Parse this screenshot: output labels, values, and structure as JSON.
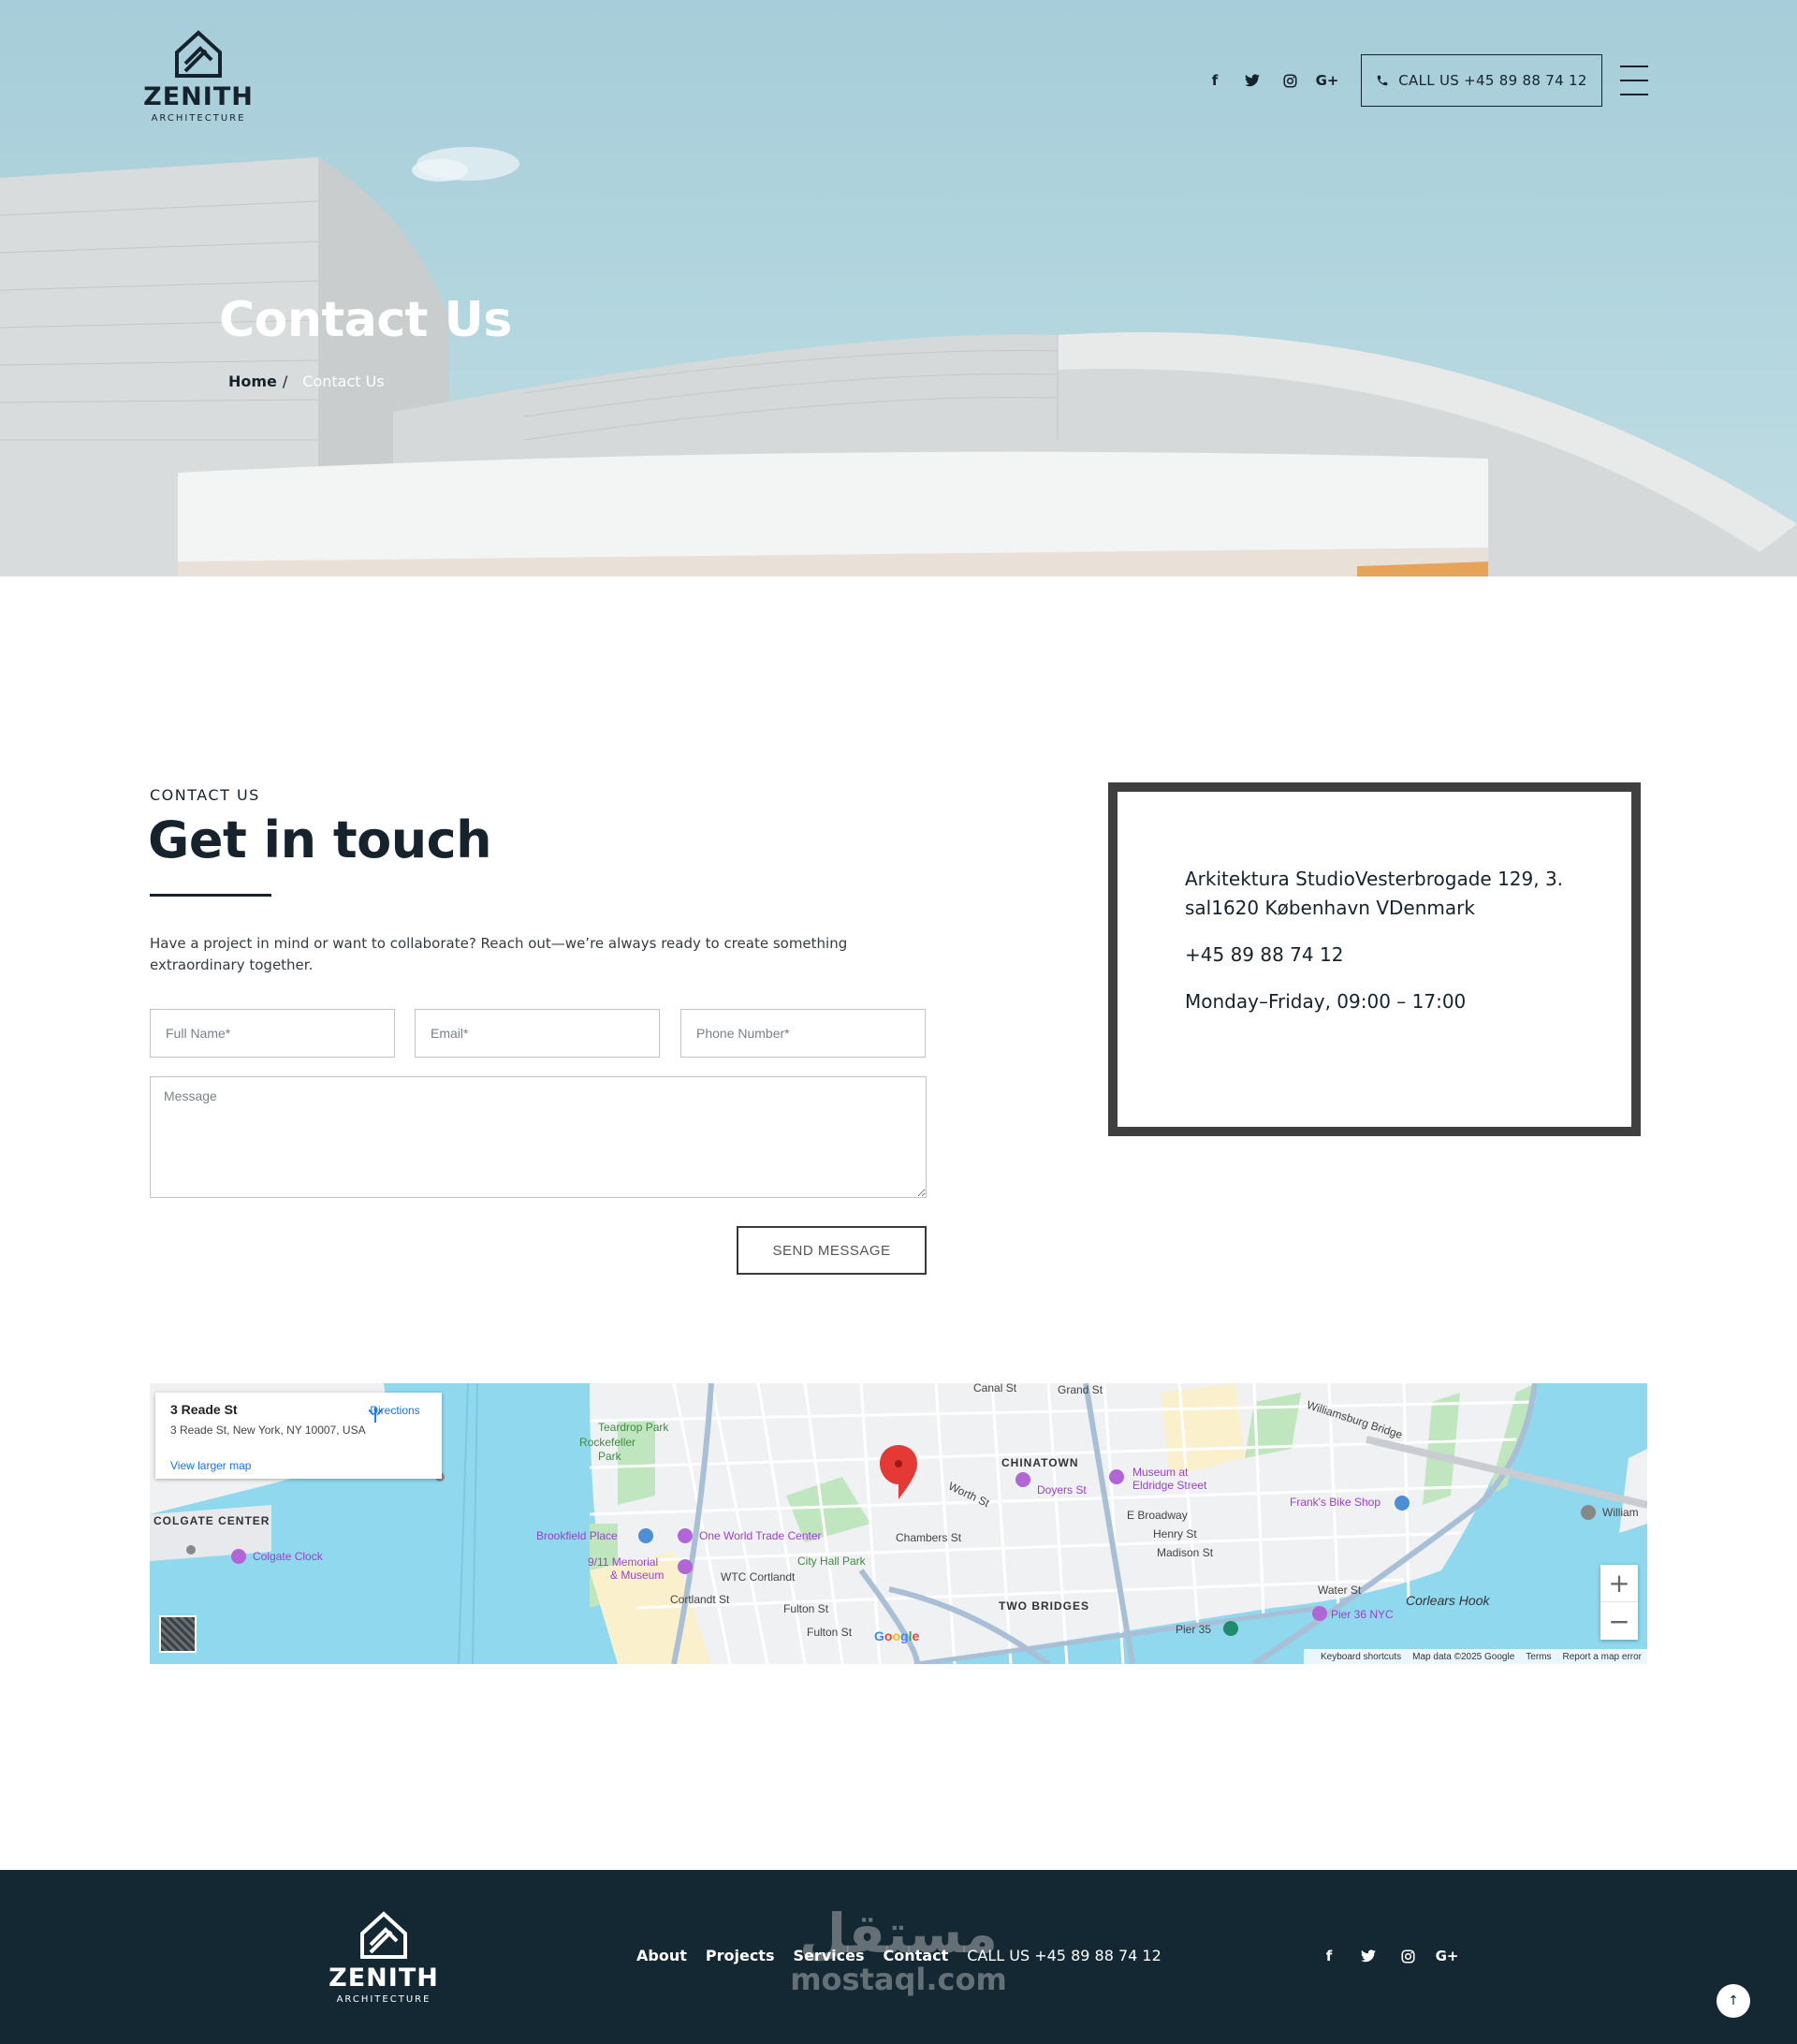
{
  "brand": {
    "name": "ZENITH",
    "tagline": "ARCHITECTURE"
  },
  "header": {
    "social": [
      {
        "icon": "facebook-icon",
        "glyph": "f"
      },
      {
        "icon": "twitter-icon",
        "glyph": "🐦"
      },
      {
        "icon": "instagram-icon",
        "glyph": "◎"
      },
      {
        "icon": "google-plus-icon",
        "glyph": "G+"
      }
    ],
    "call_label": "CALL US +45 89 88 74 12"
  },
  "hero": {
    "title": "Contact Us",
    "breadcrumb_home": "Home",
    "breadcrumb_sep": "/",
    "breadcrumb_current": "Contact Us"
  },
  "contact": {
    "eyebrow": "CONTACT US",
    "heading": "Get in touch",
    "intro": "Have a project in mind or want to collaborate? Reach out—we’re always ready to create something extraordinary together.",
    "form": {
      "name_placeholder": "Full Name*",
      "email_placeholder": "Email*",
      "phone_placeholder": "Phone Number*",
      "message_placeholder": "Message",
      "send_label": "SEND MESSAGE"
    },
    "info": {
      "address": "Arkitektura StudioVesterbrogade 129, 3. sal1620 København VDenmark",
      "phone": "+45 89 88 74 12",
      "hours": "Monday–Friday, 09:00 – 17:00"
    }
  },
  "map": {
    "place_title": "3 Reade St",
    "place_address": "3 Reade St, New York, NY 10007, USA",
    "directions_label": "Directions",
    "larger_map_label": "View larger map",
    "zoom_in": "+",
    "zoom_out": "−",
    "google_label": "Google",
    "footer_links": [
      "Keyboard shortcuts",
      "Map data ©2025 Google",
      "Terms",
      "Report a map error"
    ],
    "labels": {
      "teardrop": "Teardrop Park",
      "rockefeller": "Rockefeller",
      "park": "Park",
      "chinatown": "CHINATOWN",
      "colgate_center": "COLGATE CENTER",
      "colgate_clock": "Colgate Clock",
      "brookfield": "Brookfield Place",
      "one_wtc": "One World Trade Center",
      "memorial1": "9/11 Memorial",
      "memorial2": "& Museum",
      "wtc": "WTC Cortlandt",
      "chambers": "Chambers St",
      "city_hall": "City Hall Park",
      "cortlandt": "Cortlandt St",
      "fulton1": "Fulton St",
      "fulton2": "Fulton St",
      "two_bridges": "TWO BRIDGES",
      "doyers": "Doyers St",
      "museum1": "Museum at",
      "museum2": "Eldridge Street",
      "franks": "Frank's Bike Shop",
      "pier36": "Pier 36 NYC",
      "corlears": "Corlears Hook",
      "pier35": "Pier 35",
      "williamsburg": "Williamsburg Bridge",
      "grand": "Grand St",
      "canal": "Canal St",
      "e_broadway": "E Broadway",
      "henry": "Henry St",
      "madison": "Madison St",
      "water": "Water St",
      "william": "William",
      "worth": "Worth St"
    }
  },
  "footer": {
    "nav": [
      "About",
      "Projects",
      "Services",
      "Contact"
    ],
    "phone": "CALL US +45 89 88 74 12",
    "watermark_ar": "مستقل",
    "watermark_en": "mostaql.com",
    "top_glyph": "↑"
  },
  "colors": {
    "dark": "#16232c",
    "footer_bg": "#142833",
    "sky": "#a6cdd9",
    "water": "#8fd8ee",
    "pin": "#e53935"
  }
}
